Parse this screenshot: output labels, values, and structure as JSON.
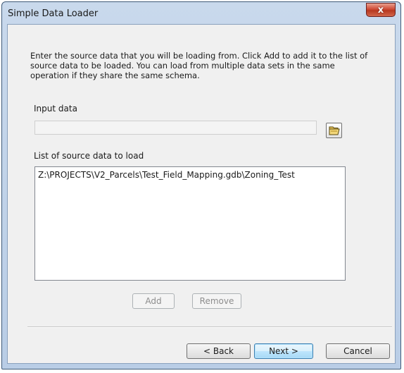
{
  "window": {
    "title": "Simple Data Loader",
    "close_glyph": "x"
  },
  "instructions": "Enter the source data that you will be loading from. Click Add to add it to the list of source data to be loaded. You can load from multiple data sets in the same operation if they share the same schema.",
  "input": {
    "label": "Input data",
    "value": "",
    "browse_icon": "open-folder-icon"
  },
  "list": {
    "label": "List of source data to load",
    "items": [
      "Z:\\PROJECTS\\V2_Parcels\\Test_Field_Mapping.gdb\\Zoning_Test"
    ]
  },
  "buttons": {
    "add": "Add",
    "remove": "Remove",
    "back": "< Back",
    "next": "Next >",
    "cancel": "Cancel"
  },
  "colors": {
    "close_button": "#c8432e",
    "default_button_border": "#3c7fb1",
    "title_bar": "#c9d9ec"
  }
}
